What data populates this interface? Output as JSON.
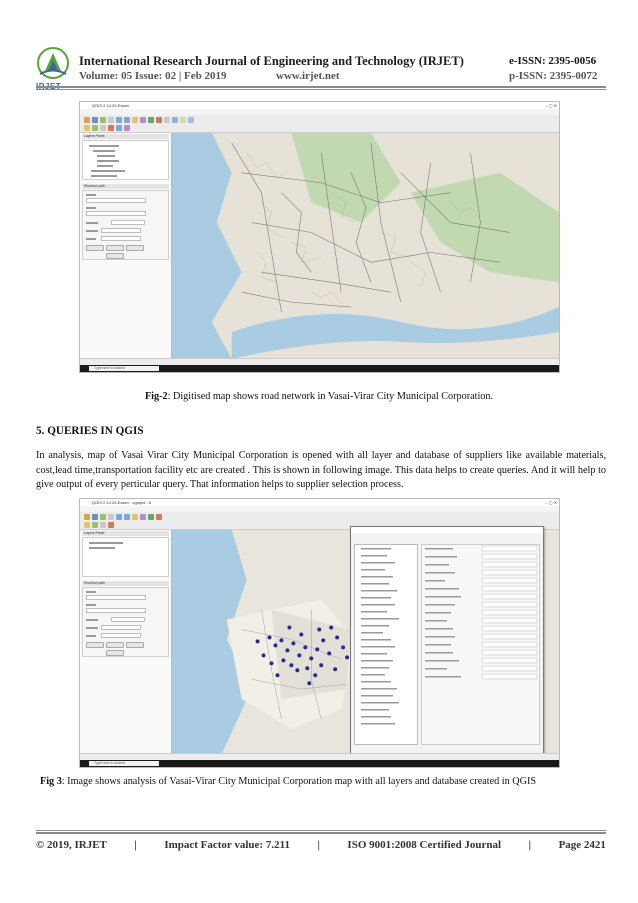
{
  "header": {
    "logo_text": "IRJET",
    "journal_title": "International Research Journal of Engineering and Technology (IRJET)",
    "e_issn": "e-ISSN: 2395-0056",
    "volume_issue": "Volume: 05 Issue: 02 | Feb 2019",
    "website": "www.irjet.net",
    "p_issn": "p-ISSN: 2395-0072"
  },
  "figure2": {
    "screenshot": {
      "window_title": "QGIS 2.14.20-Essen",
      "taskbar_search": "Type here to search"
    },
    "caption_label": "Fig-2",
    "caption_text": ": Digitised map shows road network in Vasai-Virar City Municipal Corporation."
  },
  "section": {
    "heading": "5. QUERIES IN QGIS",
    "paragraph": "In analysis, map of Vasai Virar City Municipal Corporation is opened with all layer and database of suppliers like available materials, cost,lead time,transportation facility etc are created . This is shown in following image. This data helps to create queries. And it will help to give output of every perticular query. That information helps to supplier selection process."
  },
  "figure3": {
    "screenshot": {
      "window_title": "QGIS 2.14.20-Essen - vgmpid - 8",
      "taskbar_search": "Type here to search"
    },
    "caption_label": "Fig 3",
    "caption_text": ": Image shows analysis of Vasai-Virar City Municipal Corporation map with all layers and database created in QGIS"
  },
  "footer": {
    "copyright": "© 2019, IRJET",
    "impact": "Impact Factor value: 7.211",
    "iso": "ISO 9001:2008 Certified Journal",
    "page": "Page 2421"
  },
  "colors": {
    "map_bg": "#e6e2d8",
    "water": "#a9cce3",
    "green": "#b9d6a6",
    "road": "#6a6a6a",
    "point": "#2a2a8c",
    "logo_green": "#5aa33a",
    "logo_blue": "#3a6aa0"
  }
}
